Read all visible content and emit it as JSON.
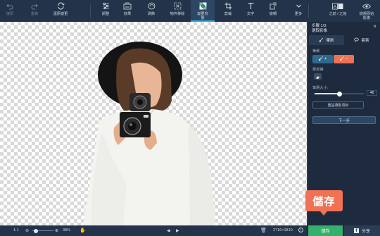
{
  "toolbar": {
    "items": [
      {
        "label": "復原",
        "icon": "undo-icon"
      },
      {
        "label": "重做",
        "icon": "redo-icon"
      },
      {
        "label": "還原變更",
        "icon": "revert-icon"
      },
      {
        "label": "調整",
        "icon": "adjust-sliders-icon"
      },
      {
        "label": "效果",
        "icon": "effects-icon"
      },
      {
        "label": "潤飾",
        "icon": "retouch-icon"
      },
      {
        "label": "物件移除",
        "icon": "object-removal-icon"
      },
      {
        "label": "變更背景",
        "icon": "change-background-icon"
      },
      {
        "label": "剪裁",
        "icon": "crop-icon"
      },
      {
        "label": "文字",
        "icon": "text-icon"
      },
      {
        "label": "旋轉",
        "icon": "rotate-icon"
      },
      {
        "label": "更多",
        "icon": "chevron-down-icon"
      },
      {
        "label": "之前 / 之後",
        "icon": "before-after-icon"
      },
      {
        "label": "檢視原始影像",
        "icon": "eye-icon"
      }
    ],
    "active": "變更背景"
  },
  "panel": {
    "step_line1": "步驟 1/3:",
    "step_line2": "選取影像",
    "tabs": [
      {
        "label": "筆刷",
        "icon": "brush-icon"
      },
      {
        "label": "套索",
        "icon": "lasso-icon"
      }
    ],
    "brush_label": "筆刷",
    "brush_add": "+",
    "brush_remove": "−",
    "eraser_label": "橡皮擦",
    "size_label": "筆刷大小:",
    "size_value": "46",
    "size_level": 0.5,
    "reset_button": "重設選取項目",
    "next_button": "下一步"
  },
  "bottom": {
    "ratio": "1:1",
    "zoom": "38%",
    "dimensions": "2716×1810"
  },
  "actions": {
    "save": "儲存",
    "share": "分享"
  },
  "callout": {
    "text": "儲存"
  },
  "colors": {
    "toolbar_bg": "#23344a",
    "panel_bg": "#1e2b3e",
    "accent_remove": "#f07153",
    "accent_add": "#2d6a8e",
    "save_green": "#35b06a",
    "active_underline": "#28b3e6"
  }
}
